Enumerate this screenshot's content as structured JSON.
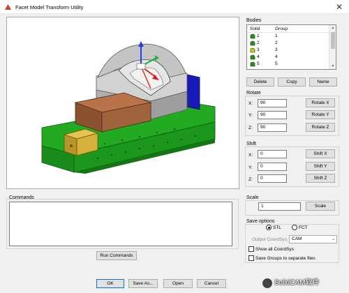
{
  "window": {
    "title": "Facet Model Transform Utility"
  },
  "bodies": {
    "label": "Bodies",
    "columns": [
      "Solid",
      "Group"
    ],
    "rows": [
      {
        "solid": "1",
        "group": "1",
        "icon_color": "#2e8b22"
      },
      {
        "solid": "2",
        "group": "2",
        "icon_color": "#2e8b22"
      },
      {
        "solid": "3",
        "group": "3",
        "icon_color": "#2e8b22"
      },
      {
        "solid": "4",
        "group": "4",
        "icon_color": "#2e8b22"
      },
      {
        "solid": "5",
        "group": "5",
        "icon_color": "#2e8b22"
      }
    ],
    "delete_label": "Delete",
    "copy_label": "Copy",
    "name_label": "Name"
  },
  "rotate": {
    "label": "Rotate",
    "x_label": "X:",
    "x_value": "90",
    "x_button": "Rotate X",
    "y_label": "Y:",
    "y_value": "90",
    "y_button": "Rotate Y",
    "z_label": "Z:",
    "z_value": "90",
    "z_button": "Rotate Z"
  },
  "shift": {
    "label": "Shift",
    "x_label": "X:",
    "x_value": "0",
    "x_button": "Shift X",
    "y_label": "Y:",
    "y_value": "0",
    "y_button": "Shift Y",
    "z_label": "Z:",
    "z_value": "0",
    "z_button": "Shift Z"
  },
  "scale": {
    "label": "Scale",
    "value": "1",
    "button": "Scale"
  },
  "commands": {
    "label": "Commands",
    "value": "",
    "run_label": "Run Commands"
  },
  "save_options": {
    "label": "Save options",
    "stl_label": "STL",
    "fct_label": "FCT",
    "selected": "STL",
    "coordsys_label": "Output CoordSys:",
    "coordsys_value": "CAM",
    "show_all_label": "Show all CoordSys",
    "save_groups_label": "Save Groups to separate files"
  },
  "footer": {
    "ok_label": "OK",
    "save_as_label": "Save As...",
    "open_label": "Open",
    "cancel_label": "Cancel"
  },
  "watermark": {
    "text": "SolidCAM软件"
  },
  "colors": {
    "part_gray": "#b8b8b8",
    "vise_green": "#22aa22",
    "jaw_brown": "#a0643c",
    "block_yellow": "#d4b23a",
    "part_blue": "#1a1ab8",
    "axis_red": "#e02020",
    "axis_blue": "#2040e0",
    "axis_green": "#20b040"
  }
}
